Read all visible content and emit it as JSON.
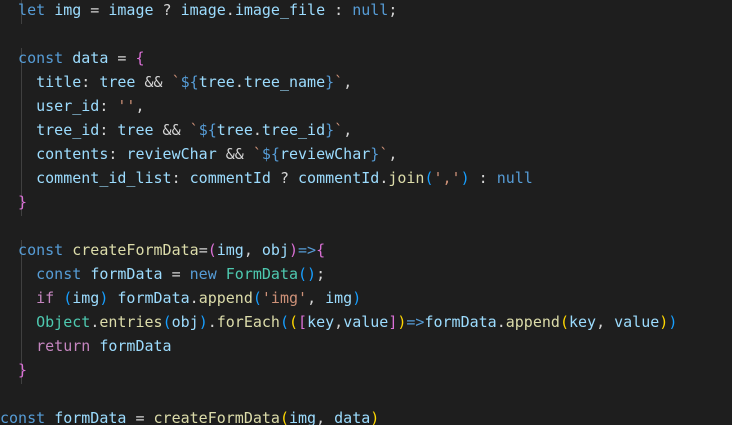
{
  "editor": {
    "background": "#1e1e1e",
    "colors": {
      "keyword": "#569cd6",
      "control": "#c586c0",
      "variable": "#9cdcfe",
      "function": "#dcdcaa",
      "string": "#ce9178",
      "class": "#4ec9b0",
      "bracket1": "#ffd700",
      "bracket2": "#da70d6",
      "bracket3": "#179fff"
    },
    "lines": [
      {
        "tokens": [
          {
            "text": "  let",
            "cls": "k"
          },
          {
            "text": " ",
            "cls": "p"
          },
          {
            "text": "img",
            "cls": "v"
          },
          {
            "text": " = ",
            "cls": "p"
          },
          {
            "text": "image",
            "cls": "v"
          },
          {
            "text": " ? ",
            "cls": "p"
          },
          {
            "text": "image",
            "cls": "v"
          },
          {
            "text": ".",
            "cls": "p"
          },
          {
            "text": "image_file",
            "cls": "v"
          },
          {
            "text": " : ",
            "cls": "p"
          },
          {
            "text": "null",
            "cls": "k"
          },
          {
            "text": ";",
            "cls": "p"
          }
        ]
      },
      {
        "tokens": []
      },
      {
        "tokens": [
          {
            "text": "  const",
            "cls": "k"
          },
          {
            "text": " ",
            "cls": "p"
          },
          {
            "text": "data",
            "cls": "v"
          },
          {
            "text": " = ",
            "cls": "p"
          },
          {
            "text": "{",
            "cls": "b2"
          }
        ]
      },
      {
        "tokens": [
          {
            "text": "    title",
            "cls": "v"
          },
          {
            "text": ": ",
            "cls": "p"
          },
          {
            "text": "tree",
            "cls": "v"
          },
          {
            "text": " && ",
            "cls": "p"
          },
          {
            "text": "`",
            "cls": "s"
          },
          {
            "text": "${",
            "cls": "k"
          },
          {
            "text": "tree",
            "cls": "v"
          },
          {
            "text": ".",
            "cls": "p"
          },
          {
            "text": "tree_name",
            "cls": "v"
          },
          {
            "text": "}",
            "cls": "k"
          },
          {
            "text": "`",
            "cls": "s"
          },
          {
            "text": ",",
            "cls": "p"
          }
        ]
      },
      {
        "tokens": [
          {
            "text": "    user_id",
            "cls": "v"
          },
          {
            "text": ": ",
            "cls": "p"
          },
          {
            "text": "''",
            "cls": "s"
          },
          {
            "text": ",",
            "cls": "p"
          }
        ]
      },
      {
        "tokens": [
          {
            "text": "    tree_id",
            "cls": "v"
          },
          {
            "text": ": ",
            "cls": "p"
          },
          {
            "text": "tree",
            "cls": "v"
          },
          {
            "text": " && ",
            "cls": "p"
          },
          {
            "text": "`",
            "cls": "s"
          },
          {
            "text": "${",
            "cls": "k"
          },
          {
            "text": "tree",
            "cls": "v"
          },
          {
            "text": ".",
            "cls": "p"
          },
          {
            "text": "tree_id",
            "cls": "v"
          },
          {
            "text": "}",
            "cls": "k"
          },
          {
            "text": "`",
            "cls": "s"
          },
          {
            "text": ",",
            "cls": "p"
          }
        ]
      },
      {
        "tokens": [
          {
            "text": "    contents",
            "cls": "v"
          },
          {
            "text": ": ",
            "cls": "p"
          },
          {
            "text": "reviewChar",
            "cls": "v"
          },
          {
            "text": " && ",
            "cls": "p"
          },
          {
            "text": "`",
            "cls": "s"
          },
          {
            "text": "${",
            "cls": "k"
          },
          {
            "text": "reviewChar",
            "cls": "v"
          },
          {
            "text": "}",
            "cls": "k"
          },
          {
            "text": "`",
            "cls": "s"
          },
          {
            "text": ",",
            "cls": "p"
          }
        ]
      },
      {
        "tokens": [
          {
            "text": "    comment_id_list",
            "cls": "v"
          },
          {
            "text": ": ",
            "cls": "p"
          },
          {
            "text": "commentId",
            "cls": "v"
          },
          {
            "text": " ? ",
            "cls": "p"
          },
          {
            "text": "commentId",
            "cls": "v"
          },
          {
            "text": ".",
            "cls": "p"
          },
          {
            "text": "join",
            "cls": "f"
          },
          {
            "text": "(",
            "cls": "b3"
          },
          {
            "text": "','",
            "cls": "s"
          },
          {
            "text": ")",
            "cls": "b3"
          },
          {
            "text": " : ",
            "cls": "p"
          },
          {
            "text": "null",
            "cls": "k"
          }
        ]
      },
      {
        "tokens": [
          {
            "text": "  }",
            "cls": "b2"
          }
        ]
      },
      {
        "tokens": []
      },
      {
        "tokens": [
          {
            "text": "  const",
            "cls": "k"
          },
          {
            "text": " ",
            "cls": "p"
          },
          {
            "text": "createFormData",
            "cls": "f"
          },
          {
            "text": "=",
            "cls": "p"
          },
          {
            "text": "(",
            "cls": "b2"
          },
          {
            "text": "img",
            "cls": "v"
          },
          {
            "text": ", ",
            "cls": "p"
          },
          {
            "text": "obj",
            "cls": "v"
          },
          {
            "text": ")",
            "cls": "b2"
          },
          {
            "text": "=>",
            "cls": "k"
          },
          {
            "text": "{",
            "cls": "b2"
          }
        ]
      },
      {
        "tokens": [
          {
            "text": "    const",
            "cls": "k"
          },
          {
            "text": " ",
            "cls": "p"
          },
          {
            "text": "formData",
            "cls": "v"
          },
          {
            "text": " = ",
            "cls": "p"
          },
          {
            "text": "new",
            "cls": "k"
          },
          {
            "text": " ",
            "cls": "p"
          },
          {
            "text": "FormData",
            "cls": "t"
          },
          {
            "text": "()",
            "cls": "b3"
          },
          {
            "text": ";",
            "cls": "p"
          }
        ]
      },
      {
        "tokens": [
          {
            "text": "    if",
            "cls": "c"
          },
          {
            "text": " ",
            "cls": "p"
          },
          {
            "text": "(",
            "cls": "b3"
          },
          {
            "text": "img",
            "cls": "v"
          },
          {
            "text": ")",
            "cls": "b3"
          },
          {
            "text": " ",
            "cls": "p"
          },
          {
            "text": "formData",
            "cls": "v"
          },
          {
            "text": ".",
            "cls": "p"
          },
          {
            "text": "append",
            "cls": "f"
          },
          {
            "text": "(",
            "cls": "b3"
          },
          {
            "text": "'img'",
            "cls": "s"
          },
          {
            "text": ", ",
            "cls": "p"
          },
          {
            "text": "img",
            "cls": "v"
          },
          {
            "text": ")",
            "cls": "b3"
          }
        ]
      },
      {
        "tokens": [
          {
            "text": "    Object",
            "cls": "t"
          },
          {
            "text": ".",
            "cls": "p"
          },
          {
            "text": "entries",
            "cls": "f"
          },
          {
            "text": "(",
            "cls": "b3"
          },
          {
            "text": "obj",
            "cls": "v"
          },
          {
            "text": ")",
            "cls": "b3"
          },
          {
            "text": ".",
            "cls": "p"
          },
          {
            "text": "forEach",
            "cls": "f"
          },
          {
            "text": "(",
            "cls": "b3"
          },
          {
            "text": "(",
            "cls": "b1"
          },
          {
            "text": "[",
            "cls": "b2"
          },
          {
            "text": "key",
            "cls": "v"
          },
          {
            "text": ",",
            "cls": "p"
          },
          {
            "text": "value",
            "cls": "v"
          },
          {
            "text": "]",
            "cls": "b2"
          },
          {
            "text": ")",
            "cls": "b1"
          },
          {
            "text": "=>",
            "cls": "k"
          },
          {
            "text": "formData",
            "cls": "v"
          },
          {
            "text": ".",
            "cls": "p"
          },
          {
            "text": "append",
            "cls": "f"
          },
          {
            "text": "(",
            "cls": "b1"
          },
          {
            "text": "key",
            "cls": "v"
          },
          {
            "text": ", ",
            "cls": "p"
          },
          {
            "text": "value",
            "cls": "v"
          },
          {
            "text": ")",
            "cls": "b1"
          },
          {
            "text": ")",
            "cls": "b3"
          }
        ]
      },
      {
        "tokens": [
          {
            "text": "    return",
            "cls": "c"
          },
          {
            "text": " ",
            "cls": "p"
          },
          {
            "text": "formData",
            "cls": "v"
          }
        ]
      },
      {
        "tokens": [
          {
            "text": "  }",
            "cls": "b2"
          }
        ]
      },
      {
        "tokens": []
      },
      {
        "tokens": [
          {
            "text": "const",
            "cls": "k"
          },
          {
            "text": " ",
            "cls": "p"
          },
          {
            "text": "formData",
            "cls": "v"
          },
          {
            "text": " = ",
            "cls": "p"
          },
          {
            "text": "createFormData",
            "cls": "f"
          },
          {
            "text": "(",
            "cls": "b1"
          },
          {
            "text": "img",
            "cls": "v"
          },
          {
            "text": ", ",
            "cls": "p"
          },
          {
            "text": "data",
            "cls": "v"
          },
          {
            "text": ")",
            "cls": "b1"
          }
        ]
      }
    ]
  }
}
